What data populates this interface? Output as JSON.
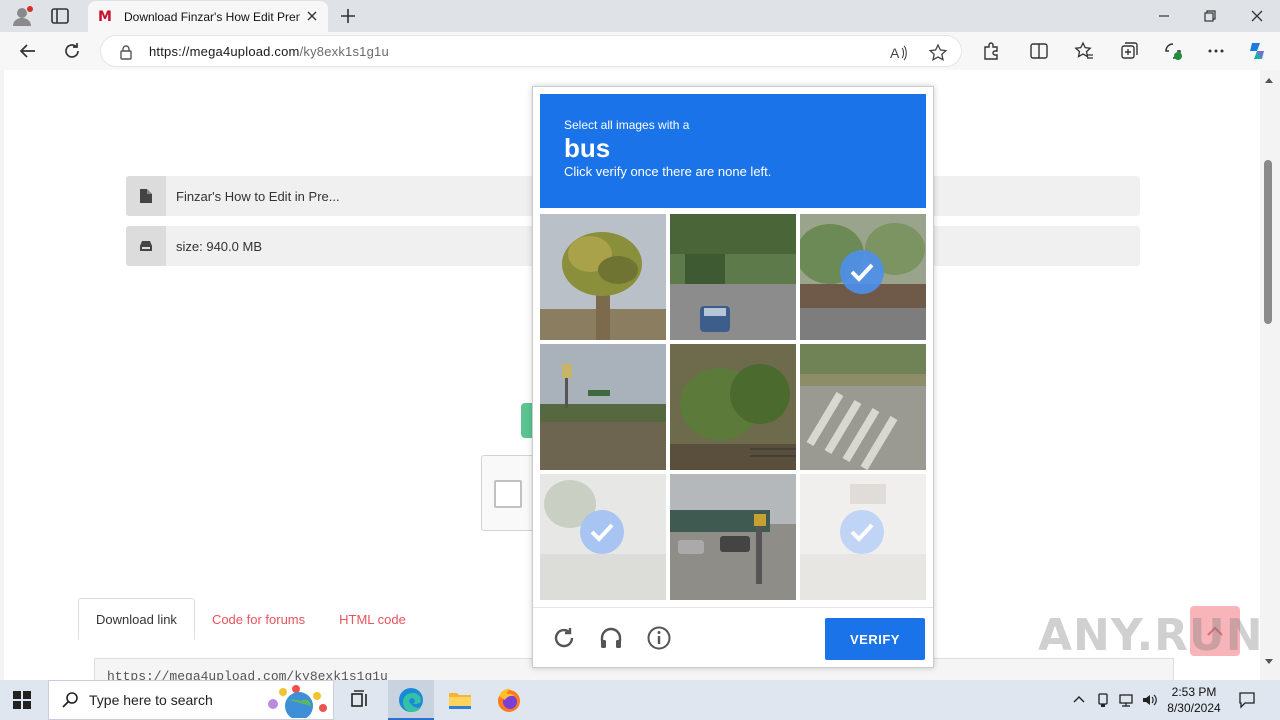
{
  "browser": {
    "tab_title": "Download Finzar's How Edit Pren",
    "url_domain": "https://mega4upload.com",
    "url_path": "/ky8exk1s1g1u"
  },
  "page": {
    "file_name": "Finzar's How to Edit in Pre...",
    "file_size": "size: 940.0 MB",
    "tabs": [
      {
        "label": "Download link"
      },
      {
        "label": "Code for forums"
      },
      {
        "label": "HTML code"
      }
    ],
    "link_value": "https://mega4upload.com/ky8exk1s1g1u"
  },
  "captcha": {
    "instruction_small": "Select all images with a",
    "target_word": "bus",
    "instruction_sub": "Click verify once there are none left.",
    "verify_label": "VERIFY",
    "tiles": [
      {
        "scene": "palm tree",
        "selected": false,
        "faded": false
      },
      {
        "scene": "street with blue car",
        "selected": false,
        "faded": false
      },
      {
        "scene": "street with trees",
        "selected": true,
        "faded": false
      },
      {
        "scene": "highway with sign",
        "selected": false,
        "faded": false
      },
      {
        "scene": "garden plants",
        "selected": false,
        "faded": false
      },
      {
        "scene": "crosswalk",
        "selected": false,
        "faded": false
      },
      {
        "scene": "road",
        "selected": true,
        "faded": true
      },
      {
        "scene": "parking lot",
        "selected": false,
        "faded": false
      },
      {
        "scene": "street",
        "selected": true,
        "faded": true
      }
    ]
  },
  "watermark": "ANY.RUN",
  "taskbar": {
    "search_placeholder": "Type here to search",
    "time": "2:53 PM",
    "date": "8/30/2024"
  },
  "colors": {
    "captcha_blue": "#1a73e8",
    "tab_link_red": "#e8545d"
  }
}
